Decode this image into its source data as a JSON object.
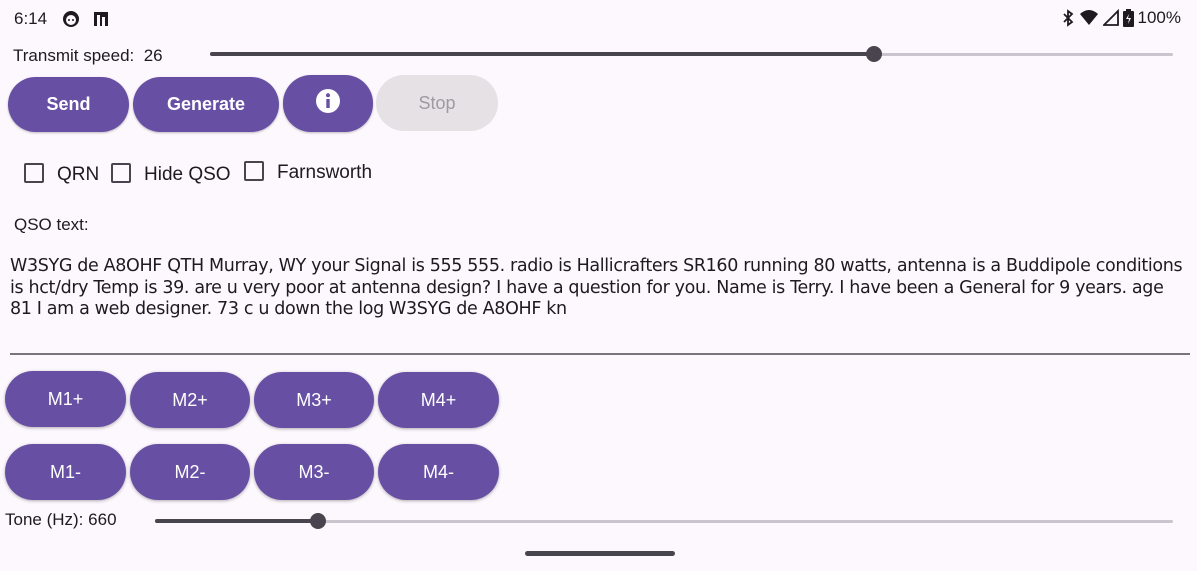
{
  "status_bar": {
    "time": "6:14",
    "left_icons": [
      "face-icon",
      "battery-saver-icon"
    ],
    "right_icons": [
      "bluetooth-icon",
      "wifi-icon",
      "signal-icon",
      "battery-icon"
    ],
    "battery_percent": "100%"
  },
  "speed": {
    "label": "Transmit speed:",
    "value": "26",
    "level": 0.69
  },
  "actions": {
    "send_label": "Send",
    "generate_label": "Generate",
    "info_icon": "info-icon",
    "stop_label": "Stop",
    "stop_enabled": false
  },
  "options": [
    {
      "label": "QRN",
      "checked": false
    },
    {
      "label": "Hide QSO",
      "checked": false
    },
    {
      "label": "Farnsworth",
      "checked": false
    }
  ],
  "qso": {
    "label": "QSO text:",
    "text": "W3SYG de A8OHF QTH Murray, WY your Signal is 555 555. radio is Hallicrafters SR160 running 80 watts, antenna is a Buddipole conditions is hct/dry Temp is 39. are u very poor at antenna design? I have a question for you. Name is Terry. I have been a General for 9 years. age 81 I am a web designer. 73 c u down the log W3SYG de A8OHF kn"
  },
  "memory": {
    "plus": [
      "M1+",
      "M2+",
      "M3+",
      "M4+"
    ],
    "minus": [
      "M1-",
      "M2-",
      "M3-",
      "M4-"
    ]
  },
  "tone": {
    "label": "Tone (Hz):",
    "value": "660",
    "level": 0.16
  },
  "colors": {
    "primary": "#6750a4",
    "background": "#fdf7fe",
    "disabled": "#e6e1e5"
  }
}
